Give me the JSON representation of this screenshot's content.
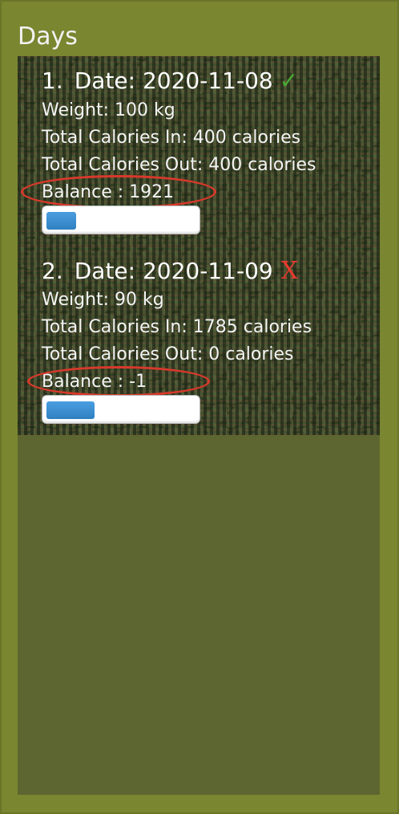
{
  "panel": {
    "title": "Days"
  },
  "days": [
    {
      "index": "1.",
      "date_label": "Date: 2020-11-08",
      "status_mark": "✓",
      "status": "ok",
      "weight": "Weight: 100 kg",
      "calories_in": "Total Calories In: 400 calories",
      "calories_out": "Total Calories Out: 400 calories",
      "balance": "Balance : 1921",
      "progress_fraction": 0.2
    },
    {
      "index": "2.",
      "date_label": "Date: 2020-11-09",
      "status_mark": "X",
      "status": "bad",
      "weight": "Weight: 90 kg",
      "calories_in": "Total Calories In: 1785 calories",
      "calories_out": "Total Calories Out: 0 calories",
      "balance": "Balance : -1",
      "progress_fraction": 0.32
    }
  ],
  "colors": {
    "background": "#7a8630",
    "list_background": "#5d6630",
    "ok_mark": "#4aa833",
    "bad_mark": "#e63a2e",
    "highlight_ring": "#d8392b",
    "progress_fill": "#2f80c0"
  }
}
